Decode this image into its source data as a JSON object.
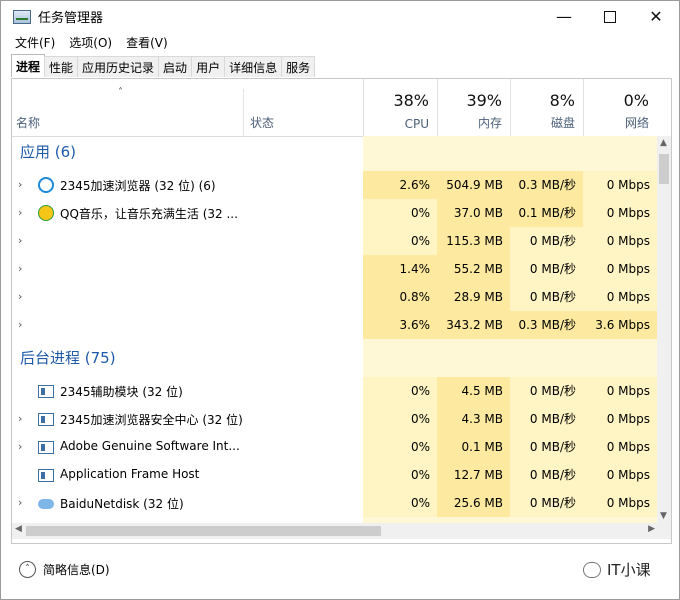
{
  "window": {
    "title": "任务管理器"
  },
  "menu": [
    "文件(F)",
    "选项(O)",
    "查看(V)"
  ],
  "tabs": [
    "进程",
    "性能",
    "应用历史记录",
    "启动",
    "用户",
    "详细信息",
    "服务"
  ],
  "active_tab": "进程",
  "header": {
    "name": "名称",
    "status": "状态",
    "cpu": {
      "pct": "38%",
      "label": "CPU"
    },
    "mem": {
      "pct": "39%",
      "label": "内存"
    },
    "disk": {
      "pct": "8%",
      "label": "磁盘"
    },
    "net": {
      "pct": "0%",
      "label": "网络"
    }
  },
  "groups": {
    "apps": "应用 (6)",
    "background": "后台进程 (75)"
  },
  "apps": [
    {
      "name": "2345加速浏览器 (32 位) (6)",
      "icon": "ie-icon",
      "cpu": "2.6%",
      "mem": "504.9 MB",
      "disk": "0.3 MB/秒",
      "net": "0 Mbps"
    },
    {
      "name": "QQ音乐，让音乐充满生活 (32 ...",
      "icon": "qqmusic-icon",
      "cpu": "0%",
      "mem": "37.0 MB",
      "disk": "0.1 MB/秒",
      "net": "0 Mbps"
    },
    {
      "name": "",
      "icon": "",
      "cpu": "0%",
      "mem": "115.3 MB",
      "disk": "0 MB/秒",
      "net": "0 Mbps"
    },
    {
      "name": "",
      "icon": "",
      "cpu": "1.4%",
      "mem": "55.2 MB",
      "disk": "0 MB/秒",
      "net": "0 Mbps"
    },
    {
      "name": "",
      "icon": "",
      "cpu": "0.8%",
      "mem": "28.9 MB",
      "disk": "0 MB/秒",
      "net": "0 Mbps"
    },
    {
      "name": "",
      "icon": "",
      "cpu": "3.6%",
      "mem": "343.2 MB",
      "disk": "0.3 MB/秒",
      "net": "3.6 Mbps"
    }
  ],
  "background": [
    {
      "name": "2345辅助模块 (32 位)",
      "icon": "window-icon",
      "cpu": "0%",
      "mem": "4.5 MB",
      "disk": "0 MB/秒",
      "net": "0 Mbps"
    },
    {
      "name": "2345加速浏览器安全中心 (32 位)",
      "icon": "window-icon",
      "cpu": "0%",
      "mem": "4.3 MB",
      "disk": "0 MB/秒",
      "net": "0 Mbps"
    },
    {
      "name": "Adobe Genuine Software Int...",
      "icon": "window-icon",
      "cpu": "0%",
      "mem": "0.1 MB",
      "disk": "0 MB/秒",
      "net": "0 Mbps"
    },
    {
      "name": "Application Frame Host",
      "icon": "window-icon",
      "cpu": "0%",
      "mem": "12.7 MB",
      "disk": "0 MB/秒",
      "net": "0 Mbps"
    },
    {
      "name": "BaiduNetdisk (32 位)",
      "icon": "cloud-icon",
      "cpu": "0%",
      "mem": "25.6 MB",
      "disk": "0 MB/秒",
      "net": "0 Mbps"
    }
  ],
  "footer": {
    "fewer_details": "简略信息(D)"
  },
  "watermark": "IT小课",
  "colors": {
    "heat_light": "#fff4c4",
    "heat_mid": "#fdeaa0",
    "group_text": "#1e5aa8"
  }
}
